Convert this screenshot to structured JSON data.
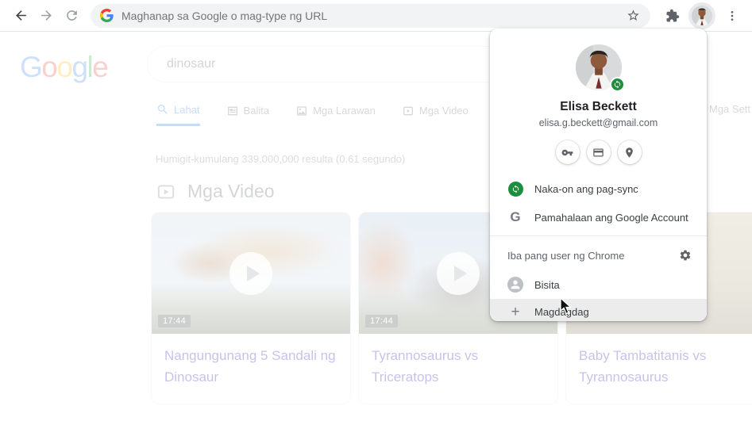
{
  "toolbar": {
    "address_placeholder": "Maghanap sa Google o mag-type ng URL"
  },
  "page": {
    "logo_letters": [
      "G",
      "o",
      "o",
      "g",
      "l",
      "e"
    ],
    "search_query": "dinosaur",
    "tabs": [
      {
        "label": "Lahat",
        "icon": "search-icon",
        "active": true
      },
      {
        "label": "Balita",
        "icon": "news-icon",
        "active": false
      },
      {
        "label": "Mga Larawan",
        "icon": "images-icon",
        "active": false
      },
      {
        "label": "Mga Video",
        "icon": "videos-icon",
        "active": false
      },
      {
        "label": "Mga Sett",
        "icon": "",
        "active": false
      }
    ],
    "result_stats": "Humigit-kumulang 339,000,000 resulta (0.61 segundo)",
    "videos_heading": "Mga Video",
    "videos": [
      {
        "title": "Nangungunang 5 Sandali ng Dinosaur",
        "duration": "17:44"
      },
      {
        "title": "Tyrannosaurus vs Triceratops",
        "duration": "17:44"
      },
      {
        "title": "Baby Tambatitanis vs Tyrannosaurus",
        "duration": ""
      }
    ]
  },
  "profile_menu": {
    "name": "Elisa Beckett",
    "email": "elisa.g.beckett@gmail.com",
    "shortcuts": [
      "key-icon",
      "payment-card-icon",
      "location-pin-icon"
    ],
    "sync_status": "Naka-on ang pag-sync",
    "manage_account": "Pamahalaan ang Google Account",
    "other_users_label": "Iba pang user ng Chrome",
    "guest": "Bisita",
    "add_user": "Magdagdag"
  },
  "colors": {
    "accent_blue": "#1a73e8",
    "sync_green": "#1e8e3e",
    "link_blue": "#1a0dab"
  }
}
